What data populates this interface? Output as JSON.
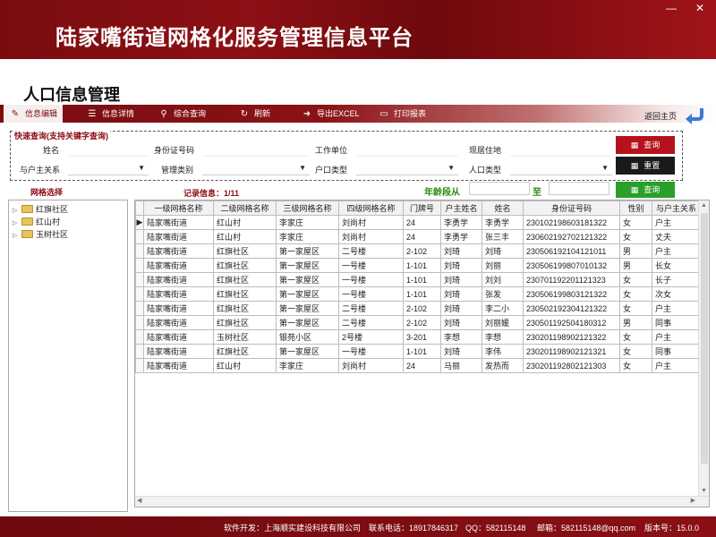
{
  "header": {
    "title": "陆家嘴街道网格化服务管理信息平台",
    "min_glyph": "—",
    "close_glyph": "✕"
  },
  "page_title": "人口信息管理",
  "toolbar": {
    "items": [
      {
        "label": "信息编辑",
        "icon": "edit-icon"
      },
      {
        "label": "信息详情",
        "icon": "list-icon"
      },
      {
        "label": "综合查询",
        "icon": "search-icon"
      },
      {
        "label": "刷新",
        "icon": "refresh-icon"
      },
      {
        "label": "导出EXCEL",
        "icon": "export-icon"
      },
      {
        "label": "打印报表",
        "icon": "print-icon"
      }
    ],
    "return_home": "返回主页"
  },
  "quick_search": {
    "legend": "快速查询(支持关键字查询)",
    "fields": {
      "name": "姓名",
      "id_no": "身份证号码",
      "work_unit": "工作单位",
      "address": "现居住地",
      "relation": "与户主关系",
      "mgmt_type": "管理类别",
      "hukou_type": "户口类型",
      "pop_type": "人口类型"
    },
    "search_btn": "查询",
    "reset_btn": "重置"
  },
  "grid_select_label": "网格选择",
  "record_info": "记录信息：1/11",
  "age_range": {
    "label": "年龄段从",
    "to": "至",
    "search_btn": "查询"
  },
  "tree": [
    {
      "label": "红旗社区"
    },
    {
      "label": "红山村"
    },
    {
      "label": "玉树社区"
    }
  ],
  "table": {
    "columns": [
      "一级网格名称",
      "二级网格名称",
      "三级网格名称",
      "四级网格名称",
      "门牌号",
      "户主姓名",
      "姓名",
      "身份证号码",
      "性别",
      "与户主关系"
    ],
    "rows": [
      [
        "陆家嘴街道",
        "红山村",
        "李家庄",
        "刘尚村",
        "24",
        "李勇学",
        "李勇学",
        "230102198603181322",
        "女",
        "户主"
      ],
      [
        "陆家嘴街道",
        "红山村",
        "李家庄",
        "刘尚村",
        "24",
        "李勇学",
        "张三丰",
        "230602192702121322",
        "女",
        "丈夫"
      ],
      [
        "陆家嘴街道",
        "红旗社区",
        "第一家屋区",
        "二号楼",
        "2-102",
        "刘琦",
        "刘琦",
        "230506192104121011",
        "男",
        "户主"
      ],
      [
        "陆家嘴街道",
        "红旗社区",
        "第一家屋区",
        "一号楼",
        "1-101",
        "刘琦",
        "刘丽",
        "230506199807010132",
        "男",
        "长女"
      ],
      [
        "陆家嘴街道",
        "红旗社区",
        "第一家屋区",
        "一号楼",
        "1-101",
        "刘琦",
        "刘刘",
        "230701192201121323",
        "女",
        "长子"
      ],
      [
        "陆家嘴街道",
        "红旗社区",
        "第一家屋区",
        "一号楼",
        "1-101",
        "刘琦",
        "张发",
        "230506199803121322",
        "女",
        "次女"
      ],
      [
        "陆家嘴街道",
        "红旗社区",
        "第一家屋区",
        "二号楼",
        "2-102",
        "刘琦",
        "李二小",
        "230502192304121322",
        "女",
        "户主"
      ],
      [
        "陆家嘴街道",
        "红旗社区",
        "第一家屋区",
        "二号楼",
        "2-102",
        "刘琦",
        "刘丽媛",
        "230501192504180312",
        "男",
        "同事"
      ],
      [
        "陆家嘴街道",
        "玉树社区",
        "银苑小区",
        "2号楼",
        "3-201",
        "李想",
        "李想",
        "230201198902121322",
        "女",
        "户主"
      ],
      [
        "陆家嘴街道",
        "红旗社区",
        "第一家屋区",
        "一号楼",
        "1-101",
        "刘琦",
        "李伟",
        "230201198902121321",
        "女",
        "同事"
      ],
      [
        "陆家嘴街道",
        "红山村",
        "李家庄",
        "刘尚村",
        "24",
        "马丽",
        "发热而",
        "230201192802121303",
        "女",
        "户主"
      ]
    ]
  },
  "footer": {
    "developer": "软件开发：上海顺实建设科技有限公司",
    "phone": "联系电话：18917846317",
    "qq": "QQ：582115148",
    "email": "邮箱：582115148@qq.com",
    "version": "版本号：15.0.0"
  }
}
